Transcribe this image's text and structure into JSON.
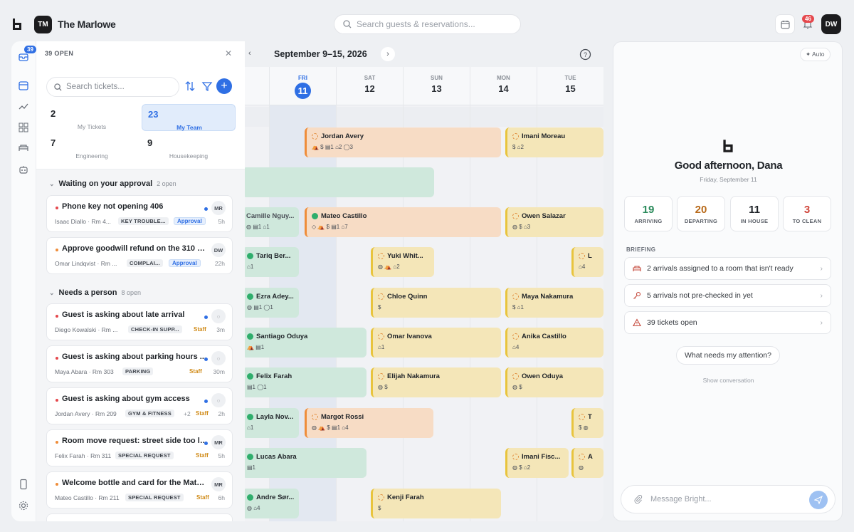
{
  "app": {
    "hotel_initials": "TM",
    "hotel_name": "The Marlowe",
    "search_placeholder": "Search guests & reservations...",
    "notifications": "46",
    "user_initials": "DW"
  },
  "rail": {
    "inbox_badge": "39"
  },
  "tickets": {
    "open_label": "39 OPEN",
    "search_placeholder": "Search tickets...",
    "stats": [
      {
        "value": "2",
        "label": "My Tickets"
      },
      {
        "value": "23",
        "label": "My Team"
      },
      {
        "value": "7",
        "label": "Engineering"
      },
      {
        "value": "9",
        "label": "Housekeeping"
      }
    ],
    "sections": [
      {
        "title": "Waiting on your approval",
        "count": "2 open"
      },
      {
        "title": "Needs a person",
        "count": "8 open"
      }
    ],
    "cards": [
      {
        "title": "Phone key not opening 406",
        "guest": "Isaac Diallo · Rm 4...",
        "tag": "KEY TROUBLE...",
        "approval": "Approval",
        "time": "5h",
        "avatar": "MR",
        "priority": "#e5484d"
      },
      {
        "title": "Approve goodwill refund on the 310 noise",
        "guest": "Omar Lindqvist · Rm ...",
        "tag": "COMPLAI...",
        "approval": "Approval",
        "time": "22h",
        "avatar": "DW",
        "priority": "#ef8d3a"
      },
      {
        "title": "Guest is asking about late arrival",
        "guest": "Diego Kowalski · Rm ...",
        "tag": "CHECK-IN SUPP...",
        "staff": "Staff",
        "time": "3m",
        "priority": "#e5484d"
      },
      {
        "title": "Guest is asking about parking hours ...",
        "guest": "Maya Abara · Rm 303",
        "tag": "PARKING",
        "staff": "Staff",
        "time": "30m",
        "priority": "#e5484d"
      },
      {
        "title": "Guest is asking about gym access",
        "guest": "Jordan Avery · Rm 209",
        "tag": "GYM & FITNESS",
        "extra": "+2",
        "staff": "Staff",
        "time": "2h",
        "priority": "#e5484d"
      },
      {
        "title": "Room move request: street side too loud",
        "guest": "Felix Farah · Rm 311",
        "tag": "SPECIAL REQUEST",
        "staff": "Staff",
        "time": "5h",
        "avatar": "MR",
        "priority": "#ef8d3a"
      },
      {
        "title": "Welcome bottle and card for the Mateo ...",
        "guest": "Mateo Castillo · Rm 211",
        "tag": "SPECIAL REQUEST",
        "staff": "Staff",
        "time": "6h",
        "avatar": "MR",
        "priority": "#ef8d3a"
      }
    ]
  },
  "calendar": {
    "title": "September 9–15, 2026",
    "days": [
      {
        "dow": "FRI",
        "num": "11"
      },
      {
        "dow": "SAT",
        "num": "12"
      },
      {
        "dow": "SUN",
        "num": "13"
      },
      {
        "dow": "MON",
        "num": "14"
      },
      {
        "dow": "TUE",
        "num": "15"
      }
    ],
    "bookings": [
      {
        "name": "Jordan Avery",
        "icons": "⛺  $  ▤1  ⌂2  ◯3"
      },
      {
        "name": "Imani Moreau",
        "icons": "$  ⌂2"
      },
      {
        "name": "Camille Nguy...",
        "icons": "◍  ▤1  ⌂1"
      },
      {
        "name": "Mateo Castillo",
        "icons": "◇  ⛺  $  ▤1  ⌂7"
      },
      {
        "name": "Owen Salazar",
        "icons": "◍  $  ⌂3"
      },
      {
        "name": "Tariq Ber...",
        "icons": "⌂1"
      },
      {
        "name": "Yuki Whit...",
        "icons": "◍  ⛺  ⌂2"
      },
      {
        "name": "L",
        "icons": "⌂4"
      },
      {
        "name": "Ezra Adey...",
        "icons": "◍  ▤1  ◯1"
      },
      {
        "name": "Chloe Quinn",
        "icons": "$"
      },
      {
        "name": "Maya Nakamura",
        "icons": "$  ⌂1"
      },
      {
        "name": "Santiago Oduya",
        "icons": "⛺  ▤1"
      },
      {
        "name": "Omar Ivanova",
        "icons": "⌂1"
      },
      {
        "name": "Anika Castillo",
        "icons": "⌂4"
      },
      {
        "name": "Felix Farah",
        "icons": "▤1  ◯1"
      },
      {
        "name": "Elijah Nakamura",
        "icons": "◍  $"
      },
      {
        "name": "Owen Oduya",
        "icons": "◍  $"
      },
      {
        "name": "Layla Nov...",
        "icons": "⌂1"
      },
      {
        "name": "Margot Rossi",
        "icons": "◍  ⛺  $  ▤1  ⌂4"
      },
      {
        "name": "T",
        "icons": "$  ◍"
      },
      {
        "name": "Lucas Abara",
        "icons": "▤1"
      },
      {
        "name": "Imani Fisc...",
        "icons": "◍  $  ⌂2"
      },
      {
        "name": "A",
        "icons": "◍"
      },
      {
        "name": "Andre Sør...",
        "icons": "◍  ⌂4"
      },
      {
        "name": "Kenji Farah",
        "icons": "$"
      }
    ]
  },
  "assistant": {
    "mode": "Auto",
    "greeting": "Good afternoon, Dana",
    "date": "Friday, September 11",
    "kpis": [
      {
        "value": "19",
        "label": "ARRIVING",
        "color": "#2a8a5b"
      },
      {
        "value": "20",
        "label": "DEPARTING",
        "color": "#b86a1a"
      },
      {
        "value": "11",
        "label": "IN HOUSE",
        "color": "#1f2328"
      },
      {
        "value": "3",
        "label": "TO CLEAN",
        "color": "#d0453a"
      }
    ],
    "briefing_title": "BRIEFING",
    "briefing": [
      "2 arrivals assigned to a room that isn't ready",
      "5 arrivals not pre-checked in yet",
      "39 tickets open"
    ],
    "ask": "What needs my attention?",
    "show_conversation": "Show conversation",
    "message_placeholder": "Message Bright..."
  }
}
